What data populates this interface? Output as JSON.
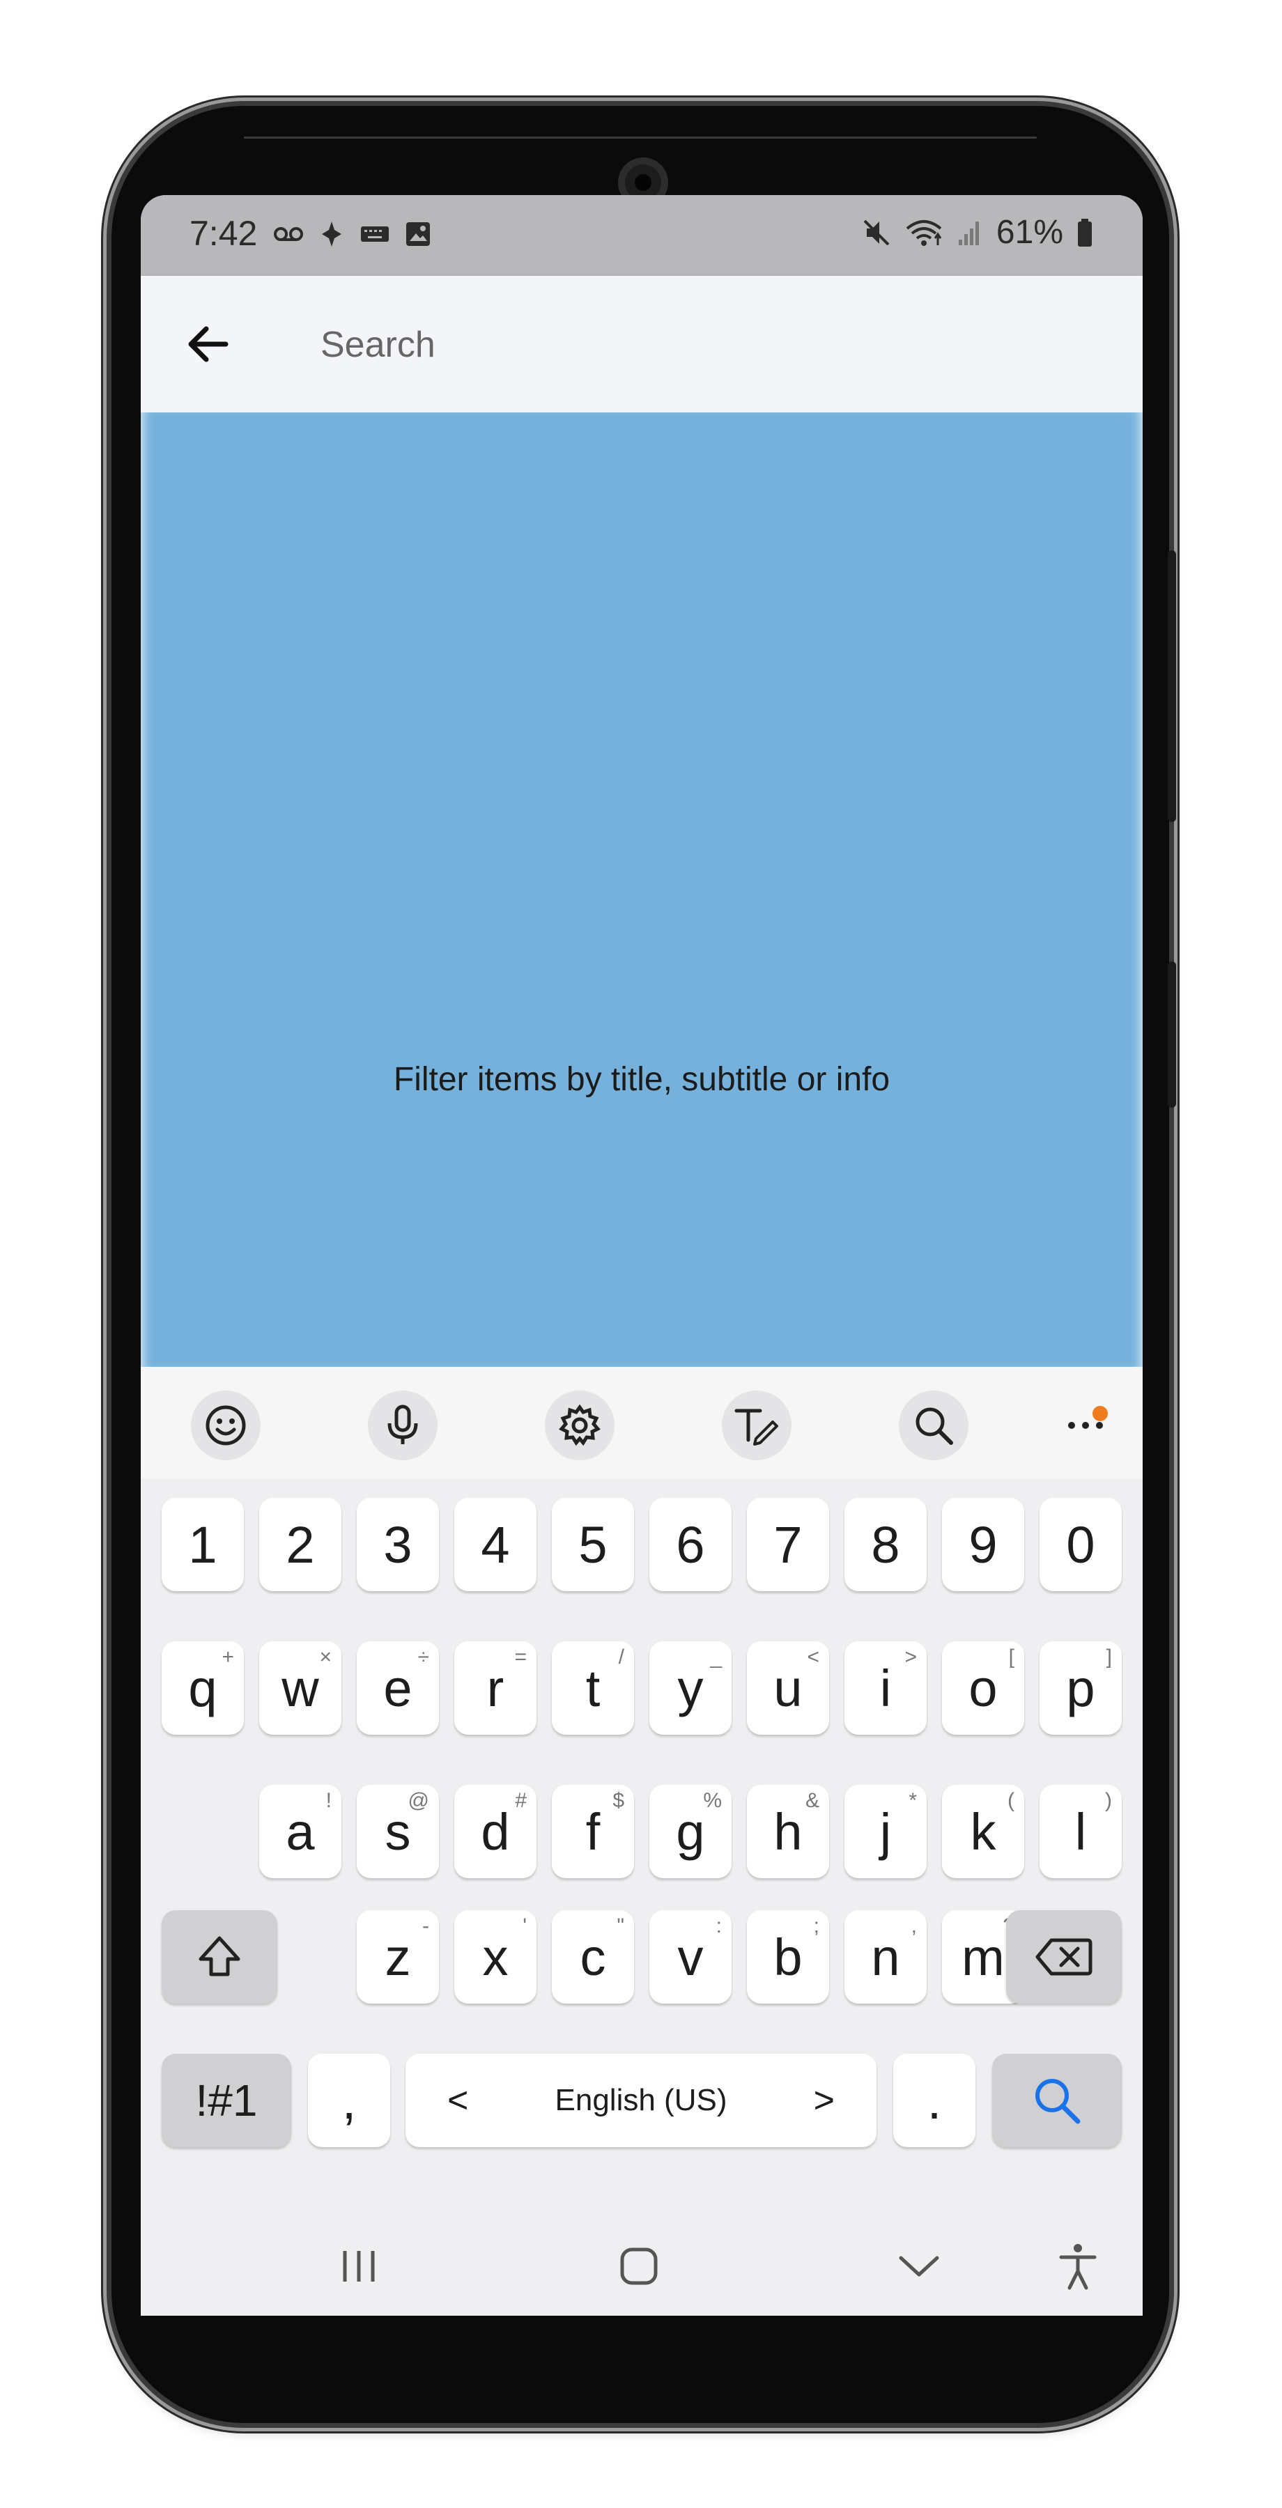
{
  "status_bar": {
    "time": "7:42",
    "battery": "61%",
    "left_icons": [
      "voicemail-icon",
      "bixby-icon",
      "keyboard-icon",
      "image-icon"
    ],
    "right_icons": [
      "mute-icon",
      "wifi-icon",
      "signal-icon",
      "battery-icon"
    ]
  },
  "appbar": {
    "search_placeholder": "Search",
    "search_value": ""
  },
  "content": {
    "hint": "Filter items by title, subtitle or info",
    "background_color": "#76b1dc"
  },
  "keyboard": {
    "toolbar": [
      "emoji-icon",
      "mic-icon",
      "settings-icon",
      "handwriting-icon",
      "search-icon",
      "more-icon"
    ],
    "row_numbers": [
      "1",
      "2",
      "3",
      "4",
      "5",
      "6",
      "7",
      "8",
      "9",
      "0"
    ],
    "row_q": [
      {
        "k": "q",
        "s": "+"
      },
      {
        "k": "w",
        "s": "×"
      },
      {
        "k": "e",
        "s": "÷"
      },
      {
        "k": "r",
        "s": "="
      },
      {
        "k": "t",
        "s": "/"
      },
      {
        "k": "y",
        "s": "_"
      },
      {
        "k": "u",
        "s": "<"
      },
      {
        "k": "i",
        "s": ">"
      },
      {
        "k": "o",
        "s": "["
      },
      {
        "k": "p",
        "s": "]"
      }
    ],
    "row_a": [
      {
        "k": "a",
        "s": "!"
      },
      {
        "k": "s",
        "s": "@"
      },
      {
        "k": "d",
        "s": "#"
      },
      {
        "k": "f",
        "s": "$"
      },
      {
        "k": "g",
        "s": "%"
      },
      {
        "k": "h",
        "s": "&"
      },
      {
        "k": "j",
        "s": "*"
      },
      {
        "k": "k",
        "s": "("
      },
      {
        "k": "l",
        "s": ")"
      }
    ],
    "row_z": [
      {
        "k": "z",
        "s": "-"
      },
      {
        "k": "x",
        "s": "'"
      },
      {
        "k": "c",
        "s": "\""
      },
      {
        "k": "v",
        "s": ":"
      },
      {
        "k": "b",
        "s": ";"
      },
      {
        "k": "n",
        "s": ","
      },
      {
        "k": "m",
        "s": "?"
      }
    ],
    "symbols_label": "!#1",
    "comma": ",",
    "space_label": "English (US)",
    "space_left": "<",
    "space_right": ">",
    "period": ".",
    "accent_color": "#1a73e8"
  },
  "navbar": [
    "recent-apps-icon",
    "home-icon",
    "hide-keyboard-icon",
    "accessibility-icon"
  ]
}
